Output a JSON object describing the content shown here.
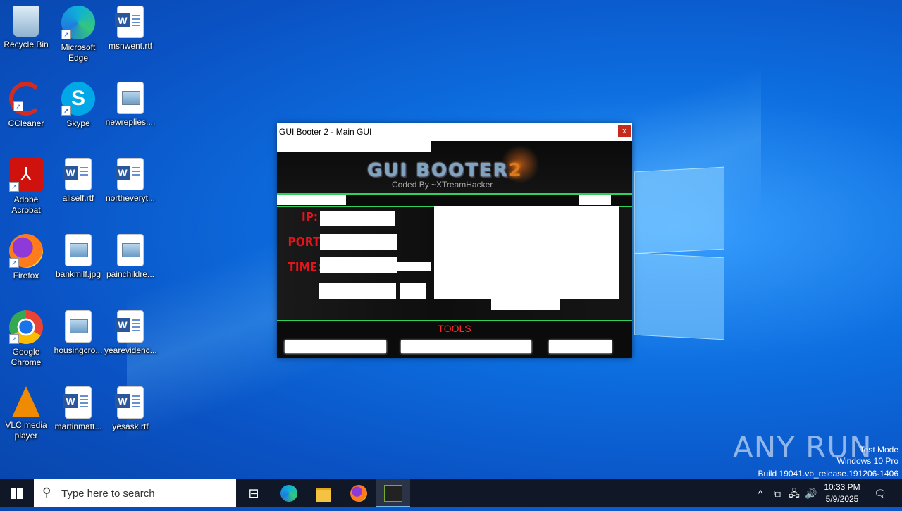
{
  "desktop": {
    "icons": [
      {
        "label": "Recycle Bin"
      },
      {
        "label": "Microsoft Edge"
      },
      {
        "label": "msnwent.rtf"
      },
      {
        "label": "CCleaner"
      },
      {
        "label": "Skype"
      },
      {
        "label": "newreplies...."
      },
      {
        "label": "Adobe Acrobat"
      },
      {
        "label": "allself.rtf"
      },
      {
        "label": "northeveryt..."
      },
      {
        "label": "Firefox"
      },
      {
        "label": "bankmilf.jpg"
      },
      {
        "label": "painchildre..."
      },
      {
        "label": "Google Chrome"
      },
      {
        "label": "housingcro..."
      },
      {
        "label": "yearevidenc..."
      },
      {
        "label": "VLC media player"
      },
      {
        "label": "martinmatt..."
      },
      {
        "label": "yesask.rtf"
      }
    ]
  },
  "window": {
    "title": "GUI Booter 2 - Main GUI",
    "close_label": "x",
    "logo_text": "GUI BOOTER",
    "logo_number": "2",
    "coded_by": "Coded By ~XTreamHacker",
    "labels": {
      "ip": "IP:",
      "port": "PORT:",
      "time": "TIME:"
    },
    "tools_label": "TOOLS"
  },
  "watermark": {
    "brand": "ANY RUN",
    "mode": "Test Mode",
    "edition": "Windows 10 Pro",
    "build": "Build 19041.vb_release.191206-1406"
  },
  "taskbar": {
    "search_placeholder": "Type here to search",
    "time": "10:33 PM",
    "date": "5/9/2025"
  },
  "colors": {
    "accent_green": "#2ed15a",
    "label_red": "#e3141b",
    "close_red": "#c42b1c"
  }
}
